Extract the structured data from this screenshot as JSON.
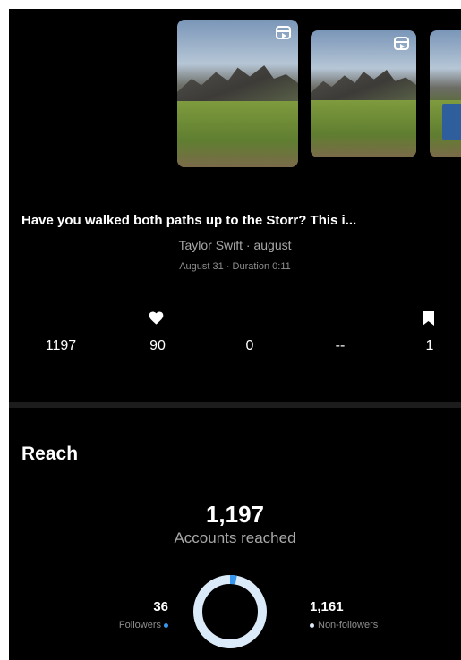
{
  "reel": {
    "caption": "Have you walked both paths up to the Storr? This i...",
    "audio": "Taylor Swift · august",
    "meta": "August 31 · Duration 0:11"
  },
  "stats": {
    "plays": "1197",
    "likes": "90",
    "comments": "0",
    "shares": "--",
    "saves": "1"
  },
  "reach": {
    "title": "Reach",
    "value": "1,197",
    "label": "Accounts reached",
    "followers_value": "36",
    "followers_label": "Followers",
    "nonfollowers_value": "1,161",
    "nonfollowers_label": "Non-followers",
    "followers_fraction": 0.03,
    "colors": {
      "followers": "#3897f0",
      "nonfollowers": "#dbeaf8"
    }
  },
  "icons": {
    "thumb": "reel-icon",
    "likes": "heart-icon",
    "saves": "bookmark-icon"
  }
}
